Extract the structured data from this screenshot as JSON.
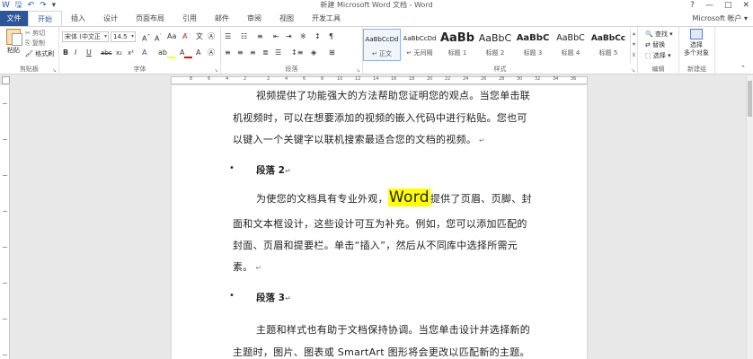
{
  "title_bar": {
    "title": "新建 Microsoft Word 文档 - Word",
    "controls": [
      "?",
      "—",
      "□",
      "✕"
    ]
  },
  "tabs": [
    "文件",
    "开始",
    "插入",
    "设计",
    "页面布局",
    "引用",
    "邮件",
    "审阅",
    "视图",
    "开发工具"
  ],
  "account": "Microsoft 帐户 ▾",
  "clipboard": {
    "paste": "粘贴",
    "cut": "✂ 剪切",
    "copy": "⎘ 复制",
    "format_painter": "🖌 格式刷",
    "label": "剪贴板"
  },
  "font": {
    "name": "宋体 (中文正",
    "size": "14.5",
    "label": "字体"
  },
  "paragraph": {
    "label": "段落"
  },
  "styles": {
    "label": "样式",
    "items": [
      {
        "preview": "AaBbCcDd",
        "name": "↵ 正文"
      },
      {
        "preview": "AaBbCcDd",
        "name": "↵ 无间隔"
      },
      {
        "preview": "AaBb",
        "name": "标题 1"
      },
      {
        "preview": "AaBbC",
        "name": "标题 2"
      },
      {
        "preview": "AaBbC",
        "name": "标题 3"
      },
      {
        "preview": "AaBbC",
        "name": "标题 4"
      },
      {
        "preview": "AaBbCc",
        "name": "标题 5"
      }
    ]
  },
  "editing": {
    "find": "查找 ▾",
    "replace": "替换",
    "select": "选择 ▾",
    "label": "编辑"
  },
  "new_group": {
    "select_objects": "选择\n多个对象",
    "label": "新建组"
  },
  "document": {
    "p1_line1": "视频提供了功能强大的方法帮助您证明您的观点。当您单击联",
    "p1_line2": "机视频时，可以在想要添加的视频的嵌入代码中进行粘贴。您也可",
    "p1_line3": "以键入一个关键字以联机搜索最适合您的文档的视频。",
    "heading2": "段落 2",
    "p2_line1_a": "为使您的文档具有专业外观，",
    "p2_word": "Word",
    "p2_line1_b": "提供了页眉、页脚、封",
    "p2_line2": "面和文本框设计，这些设计可互为补充。例如，您可以添加匹配的",
    "p2_line3": "封面、页眉和提要栏。单击“插入”，然后从不同库中选择所需元",
    "p2_line4": "素。",
    "heading3": "段落 3",
    "p3_line1": "主题和样式也有助于文档保持协调。当您单击设计并选择新的",
    "p3_line2": "主题时，图片、图表或 SmartArt 图形将会更改以匹配新的主题。"
  }
}
